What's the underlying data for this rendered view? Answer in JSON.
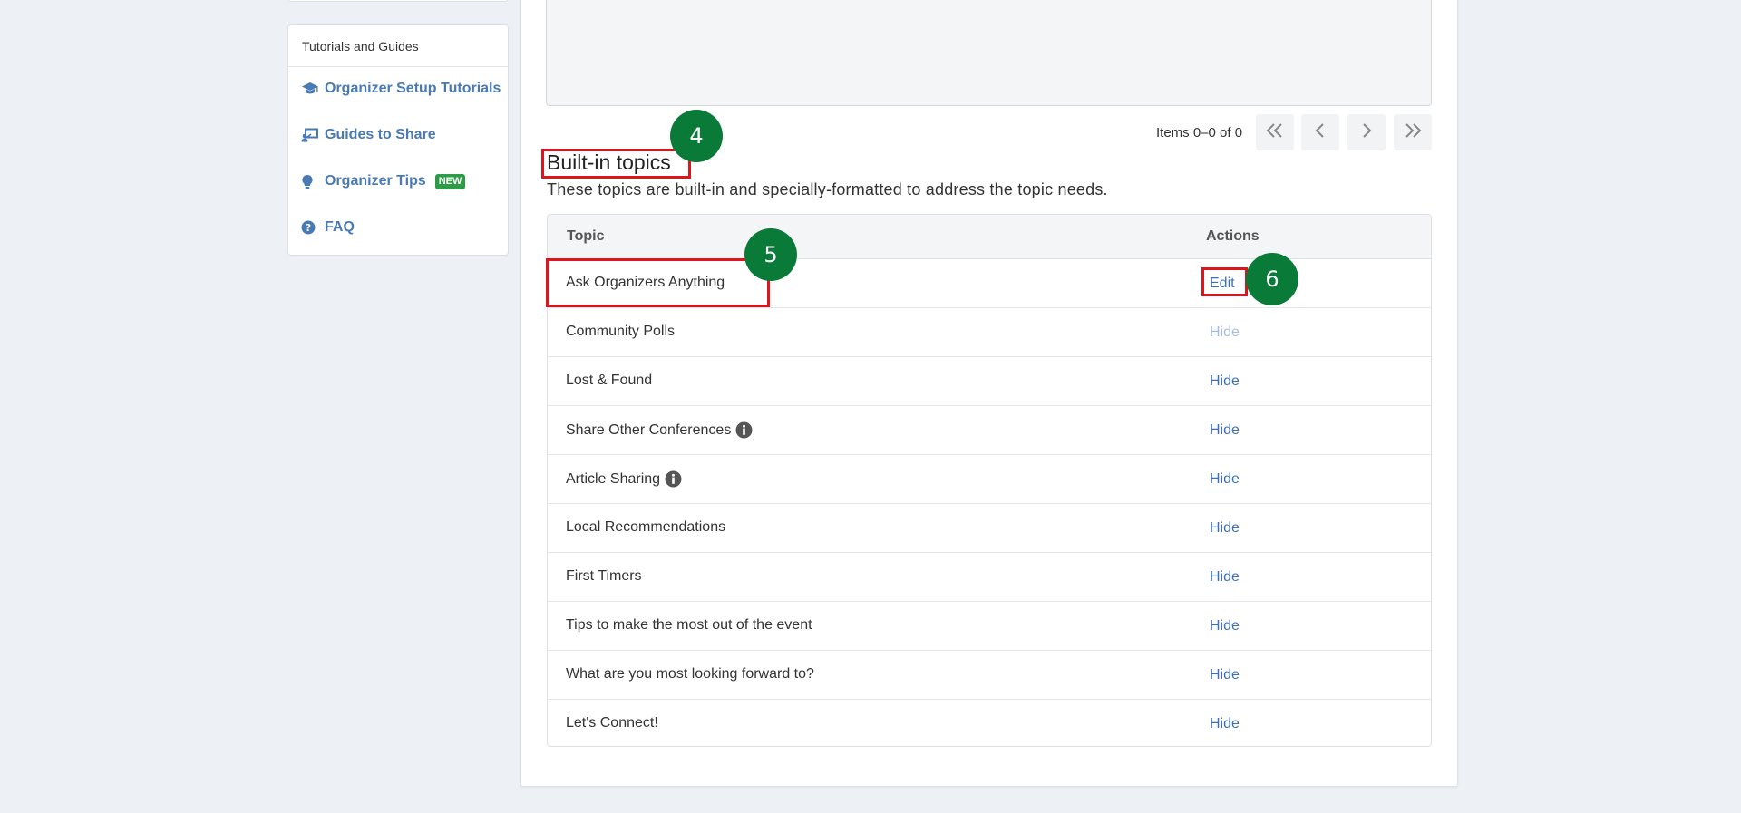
{
  "sidebar": {
    "section_title": "Tutorials and Guides",
    "items": [
      {
        "label": "Organizer Setup Tutorials",
        "icon": "graduation-cap-icon"
      },
      {
        "label": "Guides to Share",
        "icon": "presentation-icon"
      },
      {
        "label": "Organizer Tips",
        "icon": "lightbulb-icon",
        "badge": "NEW"
      },
      {
        "label": "FAQ",
        "icon": "question-circle-icon"
      }
    ]
  },
  "pager": {
    "text": "Items 0–0 of 0"
  },
  "built_in": {
    "title": "Built-in topics",
    "description": "These topics are built-in and specially-formatted to address the topic needs.",
    "columns": {
      "topic": "Topic",
      "actions": "Actions"
    },
    "rows": [
      {
        "topic": "Ask Organizers Anything",
        "action": "Edit"
      },
      {
        "topic": "Community Polls",
        "action": "Hide"
      },
      {
        "topic": "Lost & Found",
        "action": "Hide"
      },
      {
        "topic": "Share Other Conferences",
        "action": "Hide"
      },
      {
        "topic": "Article Sharing",
        "action": "Hide"
      },
      {
        "topic": "Local Recommendations",
        "action": "Hide"
      },
      {
        "topic": "First Timers",
        "action": "Hide"
      },
      {
        "topic": "Tips to make the most out of the event",
        "action": "Hide"
      },
      {
        "topic": "What are you most looking forward to?",
        "action": "Hide"
      },
      {
        "topic": "Let's Connect!",
        "action": "Hide"
      }
    ]
  },
  "annotations": {
    "marker_4": "4",
    "marker_5": "5",
    "marker_6": "6",
    "color": "#0a7a39",
    "highlight_color": "#e0141c"
  },
  "colors": {
    "link": "#3d6fb8",
    "sidebar_link": "#4a7ab4",
    "badge": "#2e9b48",
    "background": "#edf0f5"
  }
}
